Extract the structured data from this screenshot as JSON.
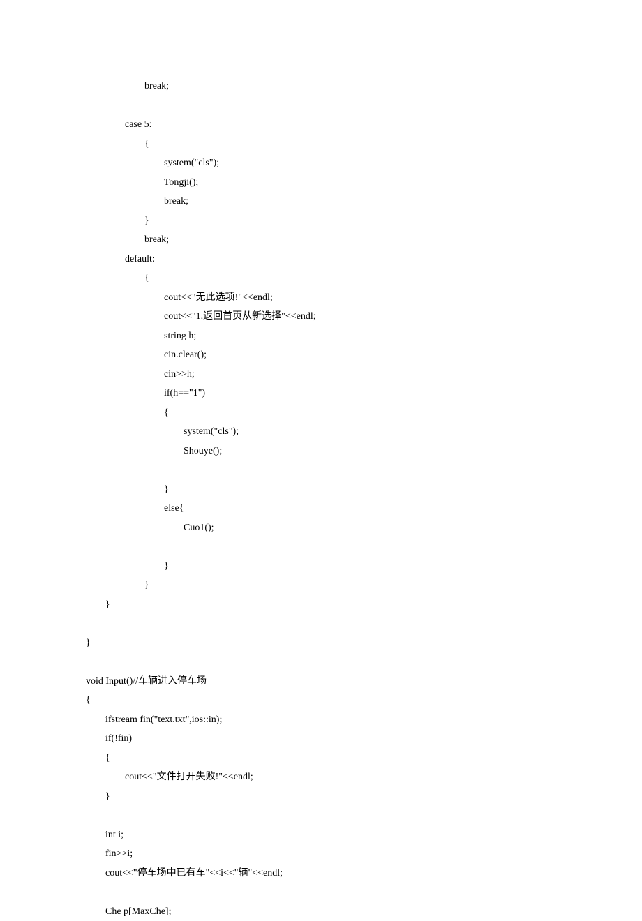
{
  "lines": [
    "                        break;",
    "",
    "                case 5:",
    "                        {",
    "                                system(\"cls\");",
    "                                Tongji();",
    "                                break;",
    "                        }",
    "                        break;",
    "                default:",
    "                        {",
    "                                cout<<\"无此选项!\"<<endl;",
    "                                cout<<\"1.返回首页从新选择\"<<endl;",
    "                                string h;",
    "                                cin.clear();",
    "                                cin>>h;",
    "                                if(h==\"1\")",
    "                                {",
    "                                        system(\"cls\");",
    "                                        Shouye();",
    "",
    "                                }",
    "                                else{",
    "                                        Cuo1();",
    "",
    "                                }",
    "                        }",
    "        }",
    "",
    "}",
    "",
    "void Input()//车辆进入停车场",
    "{",
    "        ifstream fin(\"text.txt\",ios::in);",
    "        if(!fin)",
    "        {",
    "                cout<<\"文件打开失败!\"<<endl;",
    "        }",
    "",
    "        int i;",
    "        fin>>i;",
    "        cout<<\"停车场中已有车\"<<i<<\"辆\"<<endl;",
    "",
    "        Che p[MaxChe];"
  ]
}
